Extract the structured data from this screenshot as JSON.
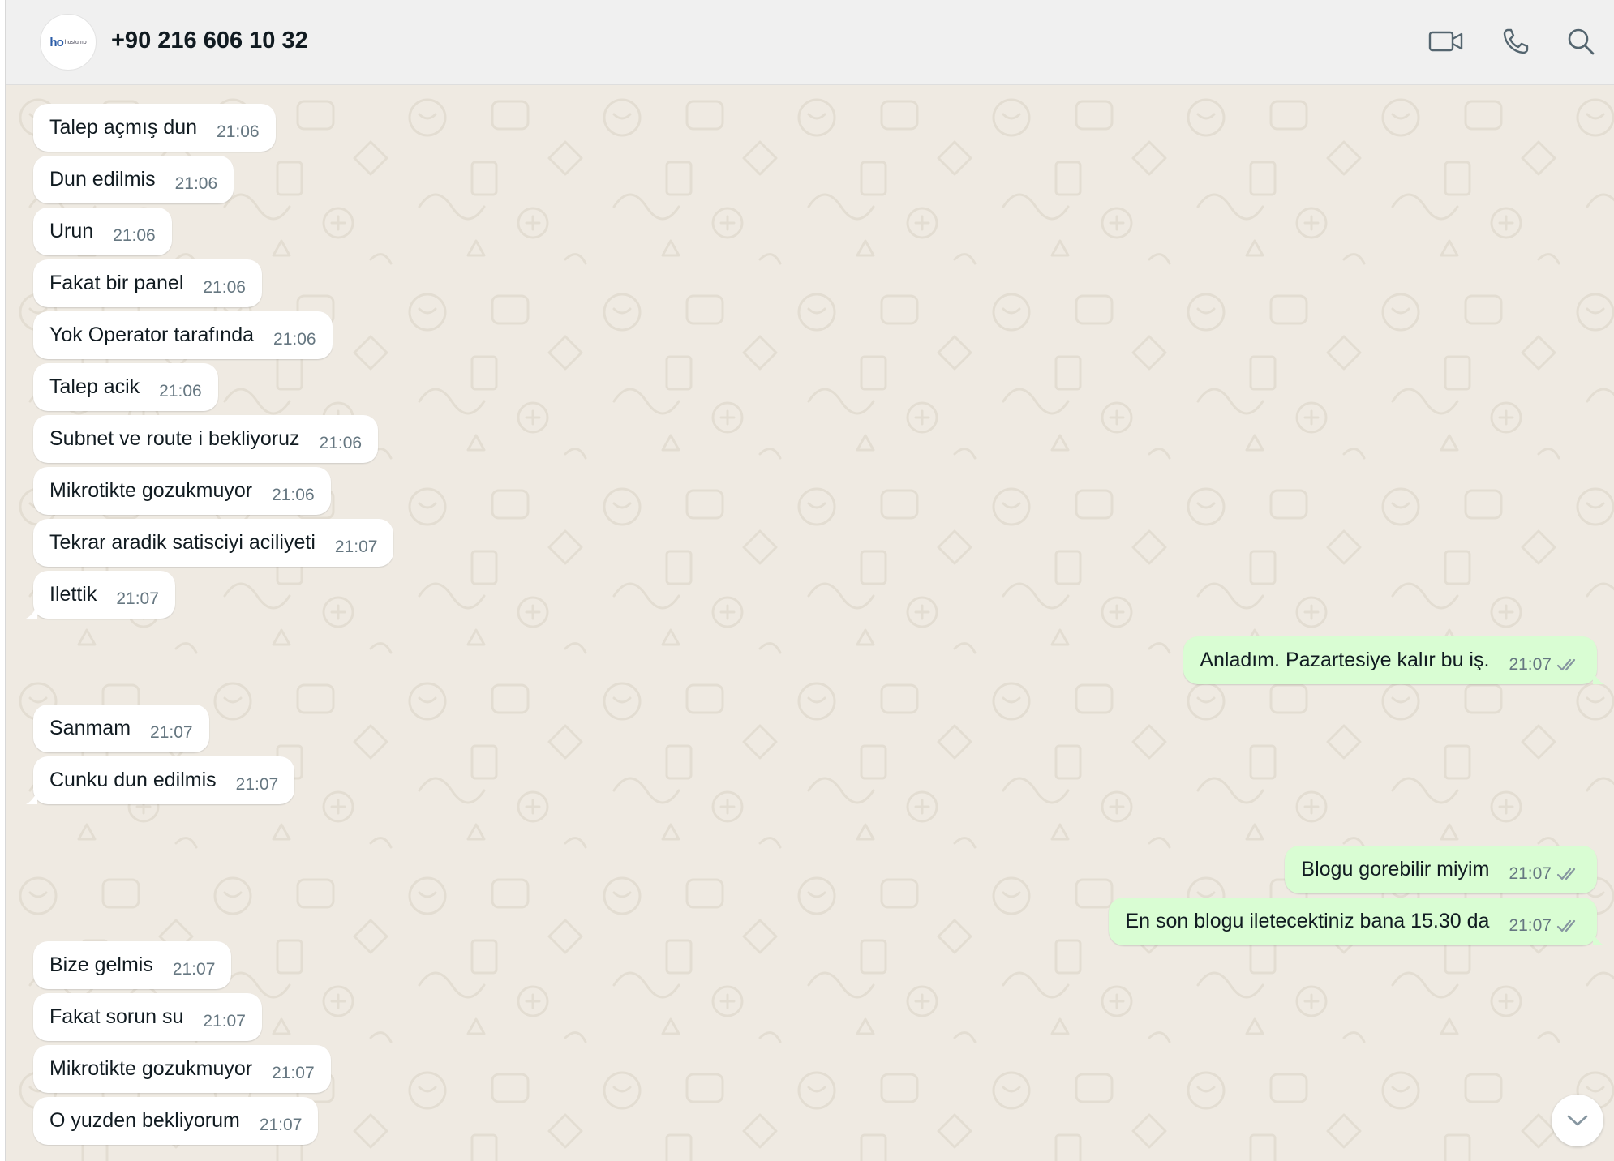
{
  "header": {
    "contact_name": "+90 216 606 10 32",
    "avatar_logo_mark": "ho",
    "avatar_logo_text": "hostumo",
    "icons": [
      "video-call-icon",
      "voice-call-icon",
      "search-icon"
    ]
  },
  "messages": [
    {
      "dir": "in",
      "text": "Talep açmış dun",
      "time": "21:06"
    },
    {
      "dir": "in",
      "text": "Dun edilmis",
      "time": "21:06"
    },
    {
      "dir": "in",
      "text": "Urun",
      "time": "21:06"
    },
    {
      "dir": "in",
      "text": "Fakat  bir panel",
      "time": "21:06"
    },
    {
      "dir": "in",
      "text": "Yok Operator tarafında",
      "time": "21:06"
    },
    {
      "dir": "in",
      "text": "Talep acik",
      "time": "21:06"
    },
    {
      "dir": "in",
      "text": "Subnet ve route i bekliyoruz",
      "time": "21:06"
    },
    {
      "dir": "in",
      "text": "Mikrotikte gozukmuyor",
      "time": "21:06"
    },
    {
      "dir": "in",
      "text": "Tekrar aradik satisciyi aciliyeti",
      "time": "21:07"
    },
    {
      "dir": "in",
      "text": "Ilettik",
      "time": "21:07"
    },
    {
      "dir": "out",
      "text": "Anladım. Pazartesiye kalır bu iş.",
      "time": "21:07",
      "status": "read"
    },
    {
      "dir": "in",
      "text": "Sanmam",
      "time": "21:07"
    },
    {
      "dir": "in",
      "text": "Cunku dun edilmis",
      "time": "21:07"
    },
    {
      "dir": "out",
      "text": "Blogu gorebilir miyim",
      "time": "21:07",
      "status": "read"
    },
    {
      "dir": "out",
      "text": "En son blogu iletecektiniz bana 15.30 da",
      "time": "21:07",
      "status": "read"
    },
    {
      "dir": "in",
      "text": "Bize gelmis",
      "time": "21:07"
    },
    {
      "dir": "in",
      "text": "Fakat sorun su",
      "time": "21:07"
    },
    {
      "dir": "in",
      "text": "Mikrotikte gozukmuyor",
      "time": "21:07"
    },
    {
      "dir": "in",
      "text": "O yuzden bekliyorum",
      "time": "21:07"
    }
  ],
  "colors": {
    "incoming_bubble": "#ffffff",
    "outgoing_bubble": "#d9fdd3",
    "chat_background": "#efeae2",
    "header_background": "#f0f0f0",
    "timestamp": "#667781",
    "read_ticks": "#8696a0"
  },
  "scroll_button_icon": "chevron-down-icon"
}
